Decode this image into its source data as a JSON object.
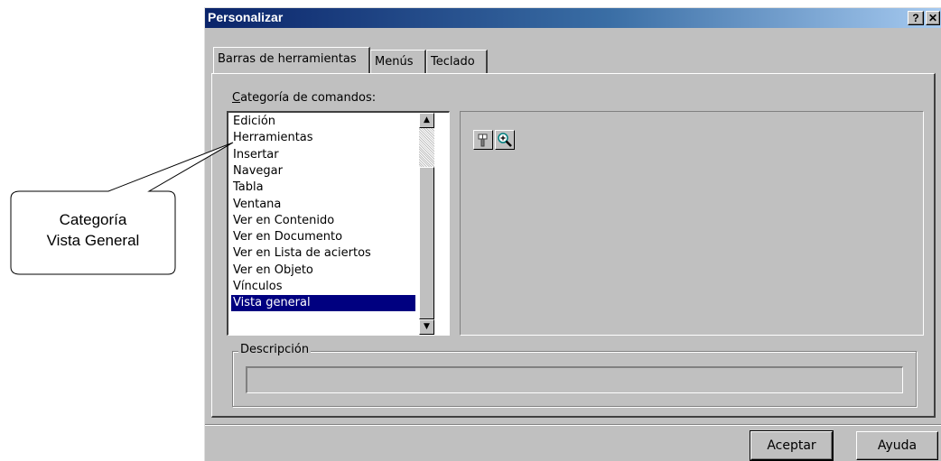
{
  "window": {
    "title": "Personalizar",
    "help_label": "?",
    "close_label": "✕"
  },
  "tabs": [
    {
      "label": "Barras de herramientas",
      "active": true
    },
    {
      "label": "Menús",
      "active": false
    },
    {
      "label": "Teclado",
      "active": false
    }
  ],
  "categories": {
    "label": "Categoría de comandos:",
    "mnemonic": "C",
    "items": [
      "Edición",
      "Herramientas",
      "Insertar",
      "Navegar",
      "Tabla",
      "Ventana",
      "Ver en Contenido",
      "Ver en Documento",
      "Ver en Lista de aciertos",
      "Ver en Objeto",
      "Vínculos",
      "Vista general"
    ],
    "selected": "Vista general",
    "scroll_up": "▲",
    "scroll_down": "▼"
  },
  "buttons_area": {
    "icons": [
      "tool-key-icon",
      "zoom-in-icon"
    ]
  },
  "description": {
    "legend": "Descripción",
    "value": ""
  },
  "footer": {
    "accept_label": "Aceptar",
    "help_label": "Ayuda"
  },
  "callout": {
    "line1": "Categoría",
    "line2": "Vista General"
  },
  "colors": {
    "titlebar_start": "#0a246a",
    "titlebar_end": "#a6caf0",
    "selection": "#000080",
    "dialog": "#c0c0c0"
  }
}
